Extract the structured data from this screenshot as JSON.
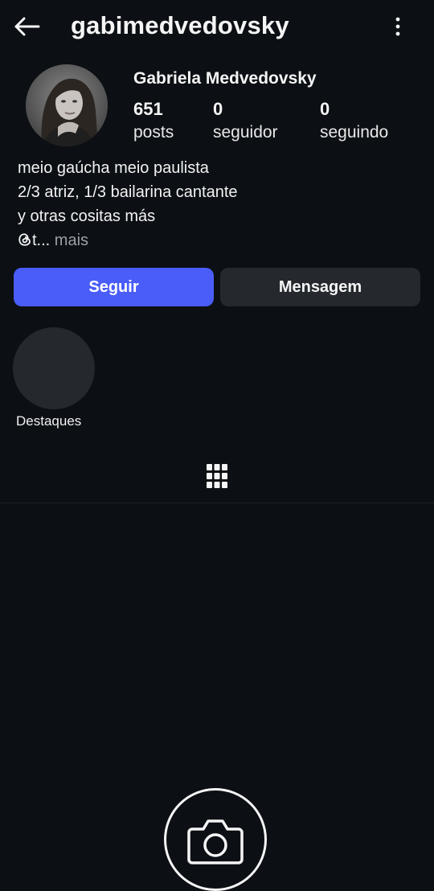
{
  "header": {
    "username": "gabimedvedovsky",
    "back_icon": "arrow-left-icon",
    "menu_icon": "more-vertical-icon"
  },
  "profile": {
    "avatar_icon": "profile-photo",
    "full_name": "Gabriela Medvedovsky",
    "stats": [
      {
        "value": "651",
        "label": "posts"
      },
      {
        "value": "0",
        "label": "seguidor"
      },
      {
        "value": "0",
        "label": "seguindo"
      }
    ],
    "bio": {
      "line1": "meio gaúcha meio paulista",
      "line2": "2/3 atriz, 1/3 bailarina cantante",
      "line3": "y otras cositas más",
      "line4_prefix": "t...",
      "line4_more": " mais",
      "threads_icon": "threads-icon"
    }
  },
  "actions": {
    "follow_label": "Seguir",
    "message_label": "Mensagem"
  },
  "highlights": {
    "label": "Destaques"
  },
  "tabs": {
    "grid_icon": "grid-icon"
  },
  "empty_state": {
    "camera_icon": "camera-icon"
  },
  "colors": {
    "background": "#0c1014",
    "accent": "#4a5df9",
    "secondary_button": "#25292e"
  }
}
